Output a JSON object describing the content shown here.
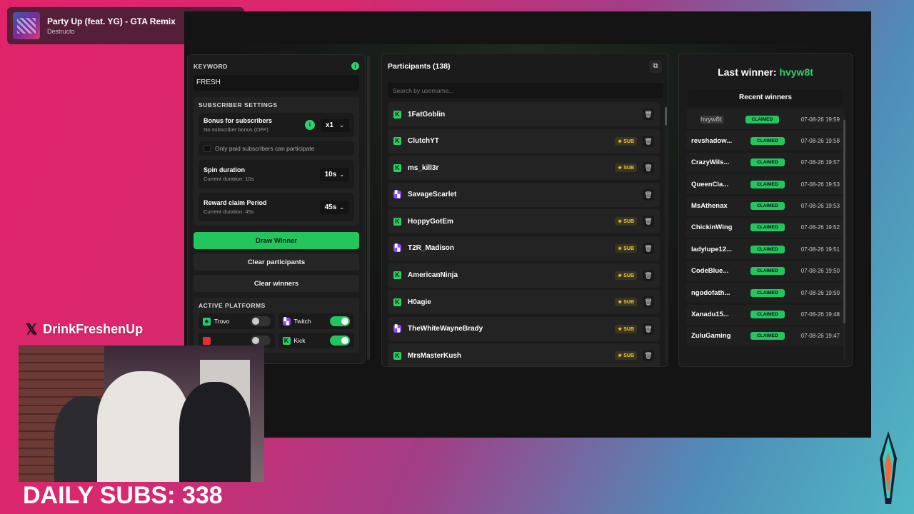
{
  "now_playing": {
    "title": "Party Up (feat. YG) - GTA Remix",
    "artist": "Destructo"
  },
  "settings": {
    "keyword_label": "KEYWORD",
    "keyword_value": "FRESH",
    "subscriber_section": "SUBSCRIBER SETTINGS",
    "bonus_title": "Bonus for subscribers",
    "bonus_sub": "No subscriber bonus (OFF)",
    "bonus_value": "x1",
    "paid_only_label": "Only paid subscribers can participate",
    "spin_title": "Spin duration",
    "spin_sub": "Current duration: 10s",
    "spin_value": "10s",
    "claim_title": "Reward claim Period",
    "claim_sub": "Current duration: 45s",
    "claim_value": "45s",
    "draw_label": "Draw Winner",
    "clear_participants_label": "Clear participants",
    "clear_winners_label": "Clear winners",
    "platforms_section": "ACTIVE PLATFORMS",
    "platforms": [
      {
        "name": "Trovo",
        "on": false
      },
      {
        "name": "Twitch",
        "on": true
      },
      {
        "name": "",
        "on": false
      },
      {
        "name": "Kick",
        "on": true
      }
    ]
  },
  "participants": {
    "title": "Participants (138)",
    "search_placeholder": "Search by username...",
    "sub_badge": "★ SUB",
    "items": [
      {
        "name": "1FatGoblin",
        "platform": "kick",
        "sub": false
      },
      {
        "name": "ClutchYT",
        "platform": "kick",
        "sub": true
      },
      {
        "name": "ms_kill3r",
        "platform": "kick",
        "sub": true
      },
      {
        "name": "SavageScarlet",
        "platform": "twitch",
        "sub": false
      },
      {
        "name": "HoppyGotEm",
        "platform": "kick",
        "sub": true
      },
      {
        "name": "T2R_Madison",
        "platform": "twitch",
        "sub": true
      },
      {
        "name": "AmericanNinja",
        "platform": "kick",
        "sub": true
      },
      {
        "name": "H0agie",
        "platform": "kick",
        "sub": true
      },
      {
        "name": "TheWhiteWayneBrady",
        "platform": "twitch",
        "sub": true
      },
      {
        "name": "MrsMasterKush",
        "platform": "kick",
        "sub": true
      }
    ]
  },
  "winners": {
    "last_label": "Last winner:",
    "last_name": "hvyw8t",
    "recent_title": "Recent winners",
    "claimed_label": "CLAIMED",
    "items": [
      {
        "name": "hvyw8t",
        "time": "07-08-26 19:59"
      },
      {
        "name": "revshadow...",
        "time": "07-08-26 19:58"
      },
      {
        "name": "CrazyWils...",
        "time": "07-08-26 19:57"
      },
      {
        "name": "QueenCla...",
        "time": "07-08-26 19:53"
      },
      {
        "name": "MsAthenax",
        "time": "07-08-26 19:53"
      },
      {
        "name": "ChickinWing",
        "time": "07-08-26 19:52"
      },
      {
        "name": "ladylupe12...",
        "time": "07-08-26 19:51"
      },
      {
        "name": "CodeBlue...",
        "time": "07-08-26 19:50"
      },
      {
        "name": "ngodofath...",
        "time": "07-08-26 19:50"
      },
      {
        "name": "Xanadu15...",
        "time": "07-08-26 19:48"
      },
      {
        "name": "ZuluGaming",
        "time": "07-08-26 19:47"
      }
    ]
  },
  "overlay": {
    "social_handle": "DrinkFreshenUp",
    "daily_subs": "DAILY SUBS: 338"
  },
  "colors": {
    "accent": "#22c55e",
    "kick": "#29d15e",
    "twitch": "#9146ff",
    "sub": "#f0c93a"
  }
}
